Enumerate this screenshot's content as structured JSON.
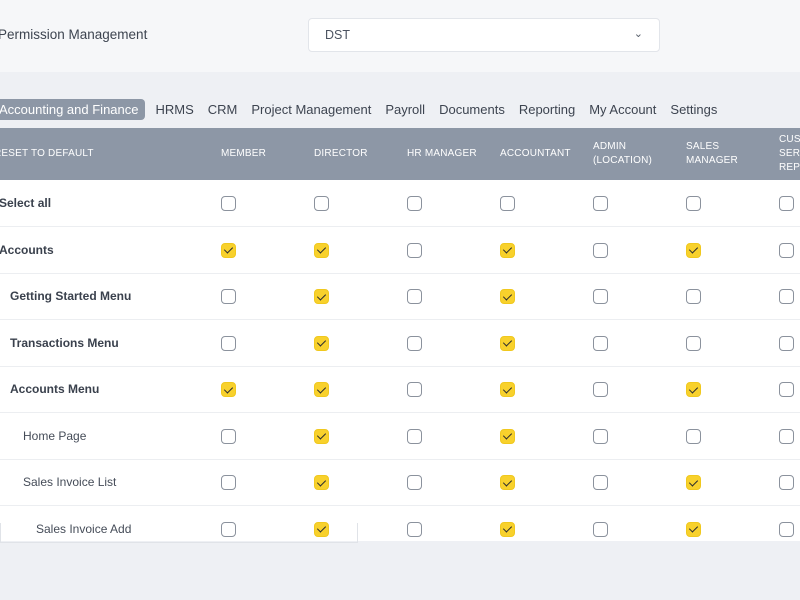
{
  "header": {
    "title": "Permission Management",
    "company_select": {
      "value": "DST"
    }
  },
  "tabs": [
    {
      "label": "Accounting and Finance",
      "active": true
    },
    {
      "label": "HRMS"
    },
    {
      "label": "CRM"
    },
    {
      "label": "Project Management"
    },
    {
      "label": "Payroll"
    },
    {
      "label": "Documents"
    },
    {
      "label": "Reporting"
    },
    {
      "label": "My Account"
    },
    {
      "label": "Settings"
    }
  ],
  "table": {
    "reset_label": "RESET TO DEFAULT",
    "columns": [
      "MEMBER",
      "DIRECTOR",
      "HR MANAGER",
      "ACCOUNTANT",
      "ADMIN\n(LOCATION)",
      "SALES\nMANAGER",
      "CUSTOMER\nSERVICE\nREP"
    ],
    "rows": [
      {
        "label": "Select all",
        "level": 0,
        "bold": true,
        "checks": [
          false,
          false,
          false,
          false,
          false,
          false,
          false
        ]
      },
      {
        "label": "Accounts",
        "level": 0,
        "bold": true,
        "checks": [
          true,
          true,
          false,
          true,
          false,
          true,
          false
        ]
      },
      {
        "label": "Getting Started Menu",
        "level": 1,
        "bold": true,
        "checks": [
          false,
          true,
          false,
          true,
          false,
          false,
          false
        ]
      },
      {
        "label": "Transactions Menu",
        "level": 1,
        "bold": true,
        "checks": [
          false,
          true,
          false,
          true,
          false,
          false,
          false
        ]
      },
      {
        "label": "Accounts Menu",
        "level": 1,
        "bold": true,
        "checks": [
          true,
          true,
          false,
          true,
          false,
          true,
          false
        ]
      },
      {
        "label": "Home Page",
        "level": 2,
        "bold": false,
        "checks": [
          false,
          true,
          false,
          true,
          false,
          false,
          false
        ]
      },
      {
        "label": "Sales Invoice List",
        "level": 2,
        "bold": false,
        "checks": [
          false,
          true,
          false,
          true,
          false,
          true,
          false
        ]
      },
      {
        "label": "Sales Invoice Add",
        "level": 3,
        "bold": false,
        "checks": [
          false,
          true,
          false,
          true,
          false,
          true,
          false
        ]
      }
    ]
  },
  "colors": {
    "accent": "#f8d12c",
    "header_bg": "#8d97a6",
    "page_bg": "#eef0f4"
  }
}
